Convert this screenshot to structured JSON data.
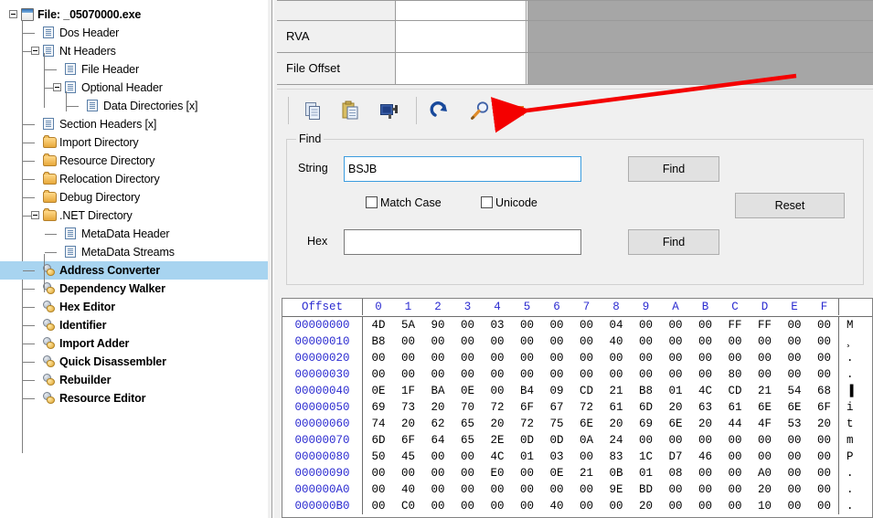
{
  "tree": {
    "items": [
      {
        "label": "File: _05070000.exe",
        "icon": "window-icon",
        "depth": 0,
        "bold": true,
        "expander": "minus",
        "selected": false
      },
      {
        "label": "Dos Header",
        "icon": "page-icon",
        "depth": 1,
        "bold": false,
        "expander": "none",
        "selected": false
      },
      {
        "label": "Nt Headers",
        "icon": "page-icon",
        "depth": 1,
        "bold": false,
        "expander": "minus",
        "selected": false
      },
      {
        "label": "File Header",
        "icon": "page-icon",
        "depth": 2,
        "bold": false,
        "expander": "none",
        "selected": false
      },
      {
        "label": "Optional Header",
        "icon": "page-icon",
        "depth": 2,
        "bold": false,
        "expander": "minus",
        "selected": false
      },
      {
        "label": "Data Directories [x]",
        "icon": "page-icon",
        "depth": 3,
        "bold": false,
        "expander": "none",
        "selected": false
      },
      {
        "label": "Section Headers [x]",
        "icon": "page-icon",
        "depth": 1,
        "bold": false,
        "expander": "none",
        "selected": false
      },
      {
        "label": "Import Directory",
        "icon": "folder-icon",
        "depth": 1,
        "bold": false,
        "expander": "none",
        "selected": false
      },
      {
        "label": "Resource Directory",
        "icon": "folder-icon",
        "depth": 1,
        "bold": false,
        "expander": "none",
        "selected": false
      },
      {
        "label": "Relocation Directory",
        "icon": "folder-icon",
        "depth": 1,
        "bold": false,
        "expander": "none",
        "selected": false
      },
      {
        "label": "Debug Directory",
        "icon": "folder-icon",
        "depth": 1,
        "bold": false,
        "expander": "none",
        "selected": false
      },
      {
        "label": ".NET Directory",
        "icon": "folder-icon",
        "depth": 1,
        "bold": false,
        "expander": "minus",
        "selected": false
      },
      {
        "label": "MetaData Header",
        "icon": "page-icon",
        "depth": 2,
        "bold": false,
        "expander": "none",
        "selected": false
      },
      {
        "label": "MetaData Streams",
        "icon": "page-icon",
        "depth": 2,
        "bold": false,
        "expander": "none",
        "selected": false
      },
      {
        "label": "Address Converter",
        "icon": "tool-icon",
        "depth": 1,
        "bold": true,
        "expander": "none",
        "selected": true
      },
      {
        "label": "Dependency Walker",
        "icon": "tool-icon",
        "depth": 1,
        "bold": true,
        "expander": "none",
        "selected": false
      },
      {
        "label": "Hex Editor",
        "icon": "tool-icon",
        "depth": 1,
        "bold": true,
        "expander": "none",
        "selected": false
      },
      {
        "label": "Identifier",
        "icon": "tool-icon",
        "depth": 1,
        "bold": true,
        "expander": "none",
        "selected": false
      },
      {
        "label": "Import Adder",
        "icon": "tool-icon",
        "depth": 1,
        "bold": true,
        "expander": "none",
        "selected": false
      },
      {
        "label": "Quick Disassembler",
        "icon": "tool-icon",
        "depth": 1,
        "bold": true,
        "expander": "none",
        "selected": false
      },
      {
        "label": "Rebuilder",
        "icon": "tool-icon",
        "depth": 1,
        "bold": true,
        "expander": "none",
        "selected": false
      },
      {
        "label": "Resource Editor",
        "icon": "tool-icon",
        "depth": 1,
        "bold": true,
        "expander": "none",
        "selected": false
      }
    ]
  },
  "converter": {
    "rows": [
      {
        "label": "RVA",
        "value": ""
      },
      {
        "label": "File Offset",
        "value": ""
      }
    ]
  },
  "toolbar": {
    "buttons": [
      {
        "name": "copy-icon",
        "title": "Copy"
      },
      {
        "name": "paste-icon",
        "title": "Paste"
      },
      {
        "name": "goto-icon",
        "title": "Go To"
      },
      {
        "name": "refresh-icon",
        "title": "Refresh"
      },
      {
        "name": "search-icon",
        "title": "Find"
      },
      {
        "name": "list-icon",
        "title": "Options"
      }
    ]
  },
  "find": {
    "legend": "Find",
    "string_label": "String",
    "string_value": "BSJB",
    "string_placeholder": "",
    "hex_label": "Hex",
    "hex_value": "",
    "hex_placeholder": "",
    "find_string_button": "Find",
    "find_hex_button": "Find",
    "reset_button": "Reset",
    "match_case_label": "Match Case",
    "match_case_checked": false,
    "unicode_label": "Unicode",
    "unicode_checked": false
  },
  "hex": {
    "offset_header": "Offset",
    "columns": [
      "0",
      "1",
      "2",
      "3",
      "4",
      "5",
      "6",
      "7",
      "8",
      "9",
      "A",
      "B",
      "C",
      "D",
      "E",
      "F"
    ],
    "rows": [
      {
        "offset": "00000000",
        "bytes": [
          "4D",
          "5A",
          "90",
          "00",
          "03",
          "00",
          "00",
          "00",
          "04",
          "00",
          "00",
          "00",
          "FF",
          "FF",
          "00",
          "00"
        ],
        "ascii": "M"
      },
      {
        "offset": "00000010",
        "bytes": [
          "B8",
          "00",
          "00",
          "00",
          "00",
          "00",
          "00",
          "00",
          "40",
          "00",
          "00",
          "00",
          "00",
          "00",
          "00",
          "00"
        ],
        "ascii": "¸"
      },
      {
        "offset": "00000020",
        "bytes": [
          "00",
          "00",
          "00",
          "00",
          "00",
          "00",
          "00",
          "00",
          "00",
          "00",
          "00",
          "00",
          "00",
          "00",
          "00",
          "00"
        ],
        "ascii": "."
      },
      {
        "offset": "00000030",
        "bytes": [
          "00",
          "00",
          "00",
          "00",
          "00",
          "00",
          "00",
          "00",
          "00",
          "00",
          "00",
          "00",
          "80",
          "00",
          "00",
          "00"
        ],
        "ascii": "."
      },
      {
        "offset": "00000040",
        "bytes": [
          "0E",
          "1F",
          "BA",
          "0E",
          "00",
          "B4",
          "09",
          "CD",
          "21",
          "B8",
          "01",
          "4C",
          "CD",
          "21",
          "54",
          "68"
        ],
        "ascii": "▐"
      },
      {
        "offset": "00000050",
        "bytes": [
          "69",
          "73",
          "20",
          "70",
          "72",
          "6F",
          "67",
          "72",
          "61",
          "6D",
          "20",
          "63",
          "61",
          "6E",
          "6E",
          "6F"
        ],
        "ascii": "i"
      },
      {
        "offset": "00000060",
        "bytes": [
          "74",
          "20",
          "62",
          "65",
          "20",
          "72",
          "75",
          "6E",
          "20",
          "69",
          "6E",
          "20",
          "44",
          "4F",
          "53",
          "20"
        ],
        "ascii": "t"
      },
      {
        "offset": "00000070",
        "bytes": [
          "6D",
          "6F",
          "64",
          "65",
          "2E",
          "0D",
          "0D",
          "0A",
          "24",
          "00",
          "00",
          "00",
          "00",
          "00",
          "00",
          "00"
        ],
        "ascii": "m"
      },
      {
        "offset": "00000080",
        "bytes": [
          "50",
          "45",
          "00",
          "00",
          "4C",
          "01",
          "03",
          "00",
          "83",
          "1C",
          "D7",
          "46",
          "00",
          "00",
          "00",
          "00"
        ],
        "ascii": "P"
      },
      {
        "offset": "00000090",
        "bytes": [
          "00",
          "00",
          "00",
          "00",
          "E0",
          "00",
          "0E",
          "21",
          "0B",
          "01",
          "08",
          "00",
          "00",
          "A0",
          "00",
          "00"
        ],
        "ascii": "."
      },
      {
        "offset": "000000A0",
        "bytes": [
          "00",
          "40",
          "00",
          "00",
          "00",
          "00",
          "00",
          "00",
          "9E",
          "BD",
          "00",
          "00",
          "00",
          "20",
          "00",
          "00"
        ],
        "ascii": "."
      },
      {
        "offset": "000000B0",
        "bytes": [
          "00",
          "C0",
          "00",
          "00",
          "00",
          "00",
          "40",
          "00",
          "00",
          "20",
          "00",
          "00",
          "00",
          "10",
          "00",
          "00"
        ],
        "ascii": "."
      }
    ]
  },
  "annotation": {
    "arrow_color": "#f40000",
    "arrow_points_to": "search-icon"
  }
}
